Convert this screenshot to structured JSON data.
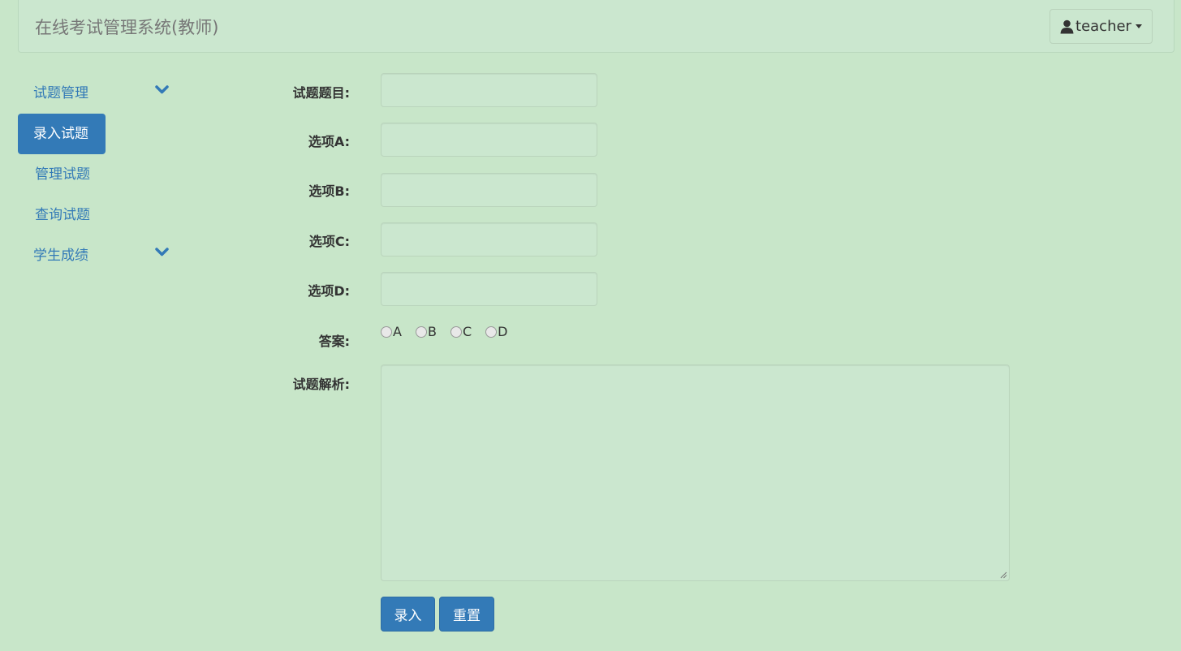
{
  "app": {
    "title": "在线考试管理系统(教师)",
    "user": "teacher"
  },
  "sidebar": {
    "items": [
      {
        "label": "试题管理"
      },
      {
        "label": "录入试题"
      },
      {
        "label": "管理试题"
      },
      {
        "label": "查询试题"
      },
      {
        "label": "学生成绩"
      }
    ]
  },
  "form": {
    "question_label": "试题题目:",
    "option_a_label": "选项A:",
    "option_b_label": "选项B:",
    "option_c_label": "选项C:",
    "option_d_label": "选项D:",
    "answer_label": "答案:",
    "answer_options": [
      "A",
      "B",
      "C",
      "D"
    ],
    "analysis_label": "试题解析:",
    "question_value": "",
    "option_a_value": "",
    "option_b_value": "",
    "option_c_value": "",
    "option_d_value": "",
    "analysis_value": ""
  },
  "buttons": {
    "submit": "录入",
    "reset": "重置"
  },
  "colors": {
    "background": "#c8e6c9",
    "primary": "#337ab7",
    "link": "#337ab7",
    "brand_text": "#777777"
  },
  "icons": {
    "user": "user-icon",
    "dropdown": "caret-down-icon",
    "expand": "chevron-down-icon"
  }
}
